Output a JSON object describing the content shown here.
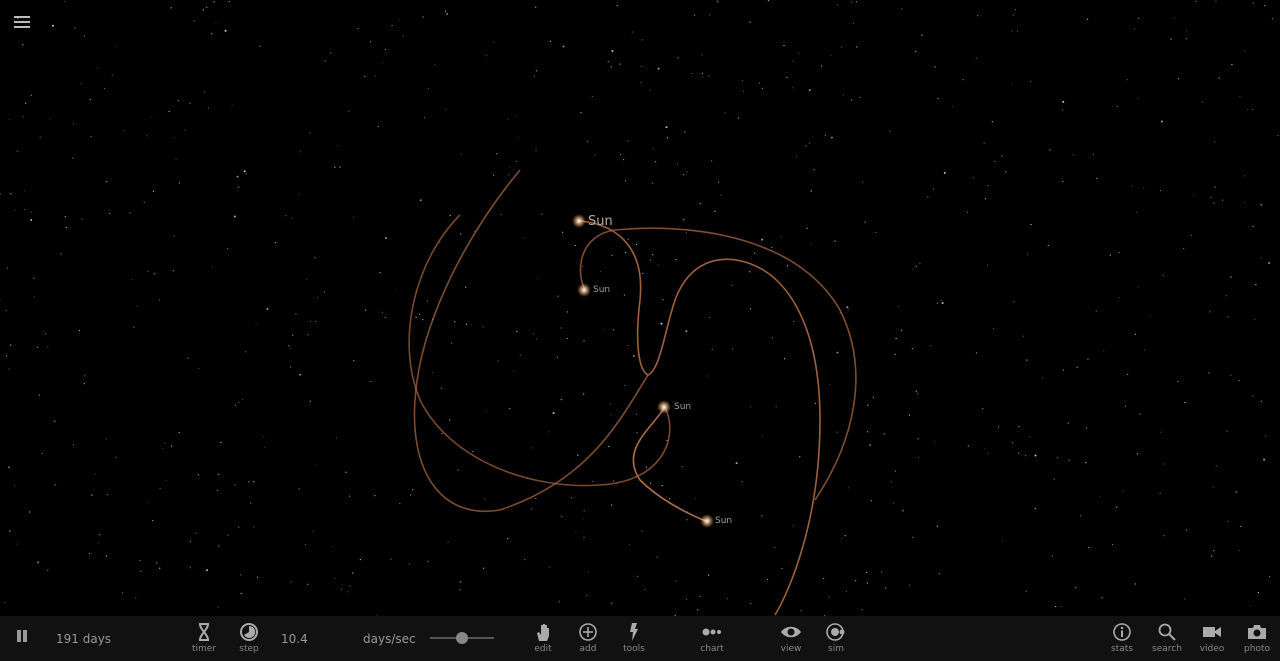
{
  "bodies": [
    {
      "label": "Sun"
    },
    {
      "label": "Sun"
    },
    {
      "label": "Sun"
    },
    {
      "label": "Sun"
    }
  ],
  "orbit_color": "#c07a4a",
  "toolbar": {
    "elapsed": "191 days",
    "timer": "timer",
    "step": "step",
    "speed_value": "10.4",
    "speed_unit": "days/sec",
    "speed_slider_fraction": 0.5,
    "edit": "edit",
    "add": "add",
    "tools": "tools",
    "chart": "chart",
    "view": "view",
    "sim": "sim",
    "stats": "stats",
    "search": "search",
    "video": "video",
    "photo": "photo"
  }
}
